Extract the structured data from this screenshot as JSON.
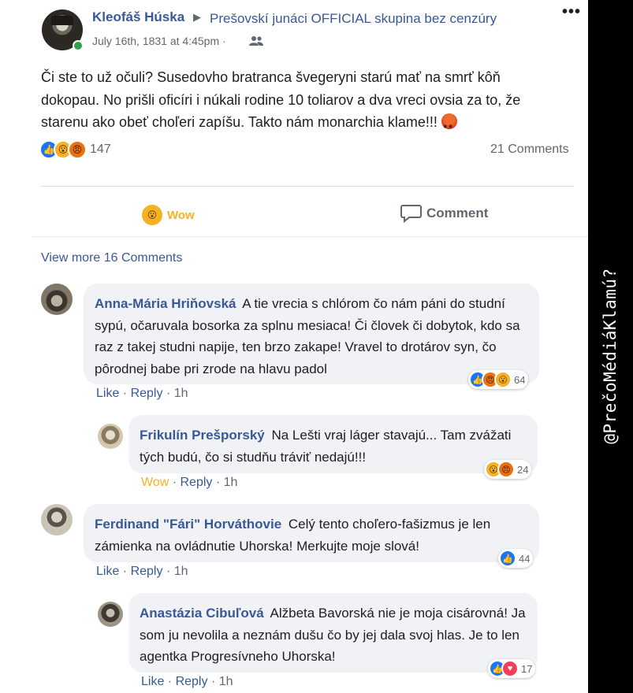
{
  "post": {
    "author": "Kleofáš Húska",
    "arrow": "▶",
    "group": "Prešovskí junáci OFFICIAL skupina bez cenzúry",
    "date": "July 16th, 1831 at 4:45pm",
    "separator": "·",
    "text": "Či ste to už očuli? Susedovho bratranca švegeryni starú mať na smrť kôň dokopau. No prišli oficíri i núkali rodine 10 toliarov a dva vreci ovsia za to, že starenu ako obeť choľeri zapíšu. Takto nám monarchia klame!!!",
    "reaction_count": "147",
    "comments_count": "21 Comments",
    "more_icon": "more-dots-icon"
  },
  "actions": {
    "wow_label": "Wow",
    "comment_label": "Comment"
  },
  "view_more": "View more 16 Comments",
  "comments": [
    {
      "name": "Anna-Mária Hriňovská",
      "text": "A tie vrecia s chlórom čo nám páni do studní sypú, očaruvala bosorka za splnu mesiaca! Či človek či dobytok, kdo sa raz z takej studni napije, ten brzo zakape! Vravel to drotárov syn, čo pôrodnej babe pri zrode na hlavu padol",
      "reactions": [
        "like",
        "angry",
        "wow"
      ],
      "count": "64",
      "like": "Like",
      "reply": "Reply",
      "time": "1h"
    },
    {
      "name": "Frikulín Prešporský",
      "text": "Na Lešti vraj láger stavajú... Tam zvážati tých budú, čo si studňu tráviť nedajú!!!",
      "reactions": [
        "wow",
        "angry"
      ],
      "count": "24",
      "like": "Wow",
      "reply": "Reply",
      "time": "1h"
    },
    {
      "name": "Ferdinand \"Fári\" Horváthovie",
      "text": "Celý tento choľero-fašizmus je len zámienka na ovládnutie Uhorska! Merkujte moje slová!",
      "reactions": [
        "like"
      ],
      "count": "44",
      "like": "Like",
      "reply": "Reply",
      "time": "1h"
    },
    {
      "name": "Anastázia Cibuľová",
      "text": "Alžbeta Bavorská nie je moja cisárovná! Ja som ju nevolila a neznám dušu čo by jej dala svoj hlas. Je to len agentka Progresívneho Uhorska!",
      "reactions": [
        "like",
        "love"
      ],
      "count": "17",
      "like": "Like",
      "reply": "Reply",
      "time": "1h"
    }
  ],
  "watermark": "@PrečoMédiáKlamú?",
  "colors": {
    "link_blue": "#385898",
    "wow_yellow": "#f7b125",
    "like_blue": "#1877f2",
    "angry_orange": "#e9710f",
    "love_red": "#f33e58",
    "bubble_bg": "#f0f2f5"
  }
}
